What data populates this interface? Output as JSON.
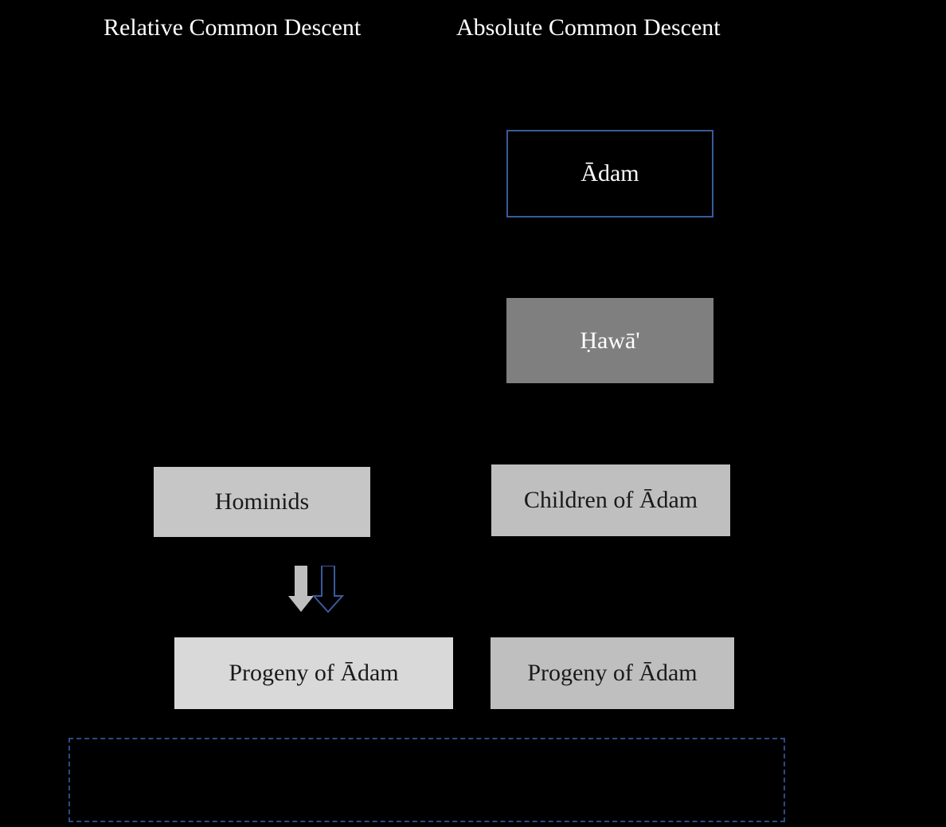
{
  "headings": {
    "left": "Relative Common Descent",
    "right": "Absolute Common Descent"
  },
  "right_column": {
    "adam": "Ādam",
    "hawa": "Ḥawā'",
    "children": "Children of Ādam",
    "progeny": "Progeny of Ādam"
  },
  "left_column": {
    "hominids": "Hominids",
    "progeny": "Progeny of Ādam"
  },
  "colors": {
    "background": "#000000",
    "border_blue": "#3a5a9a",
    "gray_dark": "#7f7f7f",
    "gray_mid": "#bfbfbf",
    "gray_light": "#d9d9d9"
  },
  "arrows": {
    "filled_color": "#bfbfbf",
    "outline_color": "#3a5a9a"
  }
}
